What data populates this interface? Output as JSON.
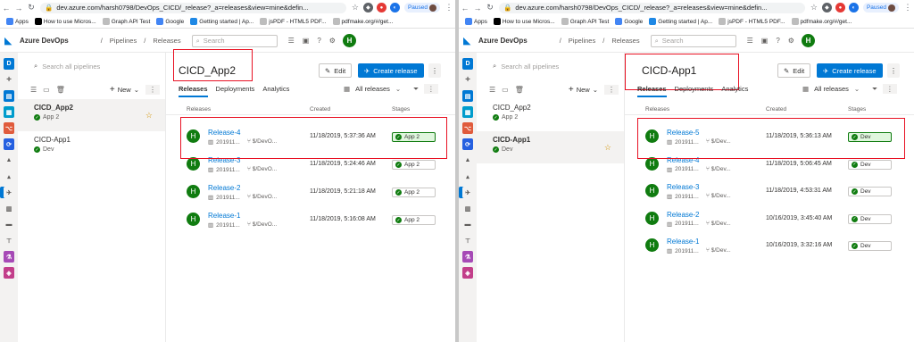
{
  "browser": {
    "url_left": "dev.azure.com/harsh0798/DevOps_CICD/_release?_a=releases&view=mine&defin...",
    "url_right": "dev.azure.com/harsh0798/DevOps_CICD/_release?_a=releases&view=mine&defin...",
    "paused_label": "Paused",
    "bookmarks_left": [
      "Apps",
      "How to use Micros...",
      "Graph API Test",
      "Google",
      "Getting started | Ap...",
      "jsPDF - HTML5 PDF...",
      "pdfmake.org/#/get..."
    ],
    "bookmarks_right": [
      "Apps",
      "How to use Micros...",
      "Graph API Test",
      "Google",
      "Getting started | Ap...",
      "jsPDF - HTML5 PDF...",
      "pdfmake.org/#/get..."
    ]
  },
  "topbar": {
    "brand": "Azure DevOps",
    "crumb_sep": "/",
    "crumb_pipelines": "Pipelines",
    "crumb_releases": "Releases",
    "search_placeholder": "Search",
    "user_initial": "H"
  },
  "sidebar": {
    "search_placeholder": "Search all pipelines",
    "new_label": "New"
  },
  "actions": {
    "edit_label": "Edit",
    "create_label": "Create release",
    "all_releases_label": "All releases"
  },
  "tabs": [
    "Releases",
    "Deployments",
    "Analytics"
  ],
  "columns": {
    "releases": "Releases",
    "created": "Created",
    "stages": "Stages"
  },
  "left": {
    "pipelines": [
      {
        "name": "CICD_App2",
        "stage": "App 2"
      },
      {
        "name": "CICD-App1",
        "stage": "Dev"
      }
    ],
    "title": "CICD_App2",
    "releases": [
      {
        "avatar": "H",
        "name": "Release-4",
        "build": "201911...",
        "source": "$/DevO...",
        "created": "11/18/2019, 5:37:36 AM",
        "stage": "App 2"
      },
      {
        "avatar": "H",
        "name": "Release-3",
        "build": "201911...",
        "source": "$/DevO...",
        "created": "11/18/2019, 5:24:46 AM",
        "stage": "App 2"
      },
      {
        "avatar": "H",
        "name": "Release-2",
        "build": "201911...",
        "source": "$/DevO...",
        "created": "11/18/2019, 5:21:18 AM",
        "stage": "App 2"
      },
      {
        "avatar": "H",
        "name": "Release-1",
        "build": "201911...",
        "source": "$/DevO...",
        "created": "11/18/2019, 5:16:08 AM",
        "stage": "App 2"
      }
    ]
  },
  "right": {
    "pipelines": [
      {
        "name": "CICD_App2",
        "stage": "App 2"
      },
      {
        "name": "CICD-App1",
        "stage": "Dev"
      }
    ],
    "title": "CICD-App1",
    "releases": [
      {
        "avatar": "H",
        "name": "Release-5",
        "build": "201911...",
        "source": "$/Dev...",
        "created": "11/18/2019, 5:36:13 AM",
        "stage": "Dev"
      },
      {
        "avatar": "H",
        "name": "Release-4",
        "build": "201911...",
        "source": "$/Dev...",
        "created": "11/18/2019, 5:06:45 AM",
        "stage": "Dev"
      },
      {
        "avatar": "H",
        "name": "Release-3",
        "build": "201911...",
        "source": "$/Dev...",
        "created": "11/18/2019, 4:53:31 AM",
        "stage": "Dev"
      },
      {
        "avatar": "H",
        "name": "Release-2",
        "build": "201911...",
        "source": "$/Dev...",
        "created": "10/16/2019, 3:45:40 AM",
        "stage": "Dev"
      },
      {
        "avatar": "H",
        "name": "Release-1",
        "build": "201911...",
        "source": "$/Dev...",
        "created": "10/16/2019, 3:32:16 AM",
        "stage": "Dev"
      }
    ]
  },
  "colors": {
    "accent": "#0078d4",
    "success": "#107c10",
    "highlight": "#e81123"
  }
}
